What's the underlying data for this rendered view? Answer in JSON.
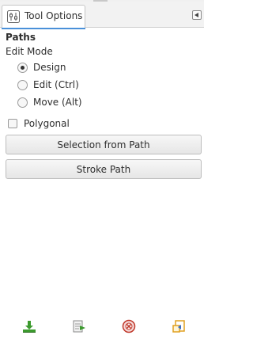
{
  "tab": {
    "label": "Tool Options",
    "icon": "tool-options-icon",
    "menu_icon": "tab-menu-arrow-icon"
  },
  "panel": {
    "section_title": "Paths",
    "edit_mode_label": "Edit Mode",
    "edit_modes": [
      {
        "label": "Design",
        "checked": true
      },
      {
        "label": "Edit (Ctrl)",
        "checked": false
      },
      {
        "label": "Move (Alt)",
        "checked": false
      }
    ],
    "polygonal": {
      "label": "Polygonal",
      "checked": false
    },
    "buttons": {
      "selection_from_path": "Selection from Path",
      "stroke_path": "Stroke Path"
    }
  },
  "bottom_bar": {
    "icons": [
      "save-options-icon",
      "restore-options-icon",
      "delete-options-icon",
      "reset-options-icon"
    ]
  },
  "colors": {
    "accent": "#4a90d9",
    "save_green": "#3c9a2e",
    "delete_red": "#c0392b",
    "reset_orange": "#e0a020"
  }
}
